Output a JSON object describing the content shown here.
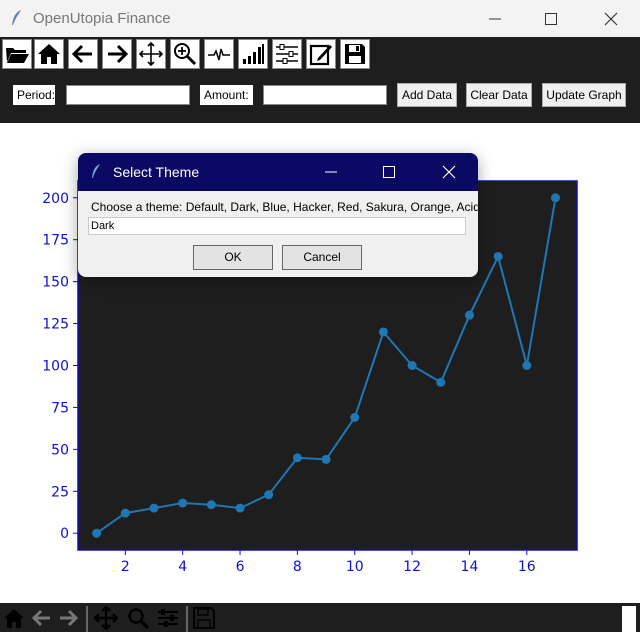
{
  "window": {
    "title": "OpenUtopia Finance"
  },
  "toolbar": {
    "icons": [
      "folder-open-icon",
      "home-icon",
      "arrow-left-icon",
      "arrow-right-icon",
      "move-icon",
      "zoom-in-icon",
      "waveform-icon",
      "signal-bars-icon",
      "sliders-icon",
      "edit-icon",
      "save-icon"
    ]
  },
  "form": {
    "period_label": "Period:",
    "period_value": "",
    "amount_label": "Amount:",
    "amount_value": "",
    "add_button": "Add Data",
    "clear_button": "Clear Data",
    "update_button": "Update Graph"
  },
  "dialog": {
    "title": "Select Theme",
    "prompt": "Choose a theme: Default, Dark, Blue, Hacker, Red, Sakura, Orange, Acid",
    "input_value": "Dark",
    "ok_label": "OK",
    "cancel_label": "Cancel"
  },
  "chart_data": {
    "type": "line",
    "x": [
      1,
      2,
      3,
      4,
      5,
      6,
      7,
      8,
      9,
      10,
      11,
      12,
      13,
      14,
      15,
      16,
      17
    ],
    "series": [
      {
        "values": [
          0,
          12,
          15,
          18,
          17,
          15,
          23,
          45,
          44,
          69,
          120,
          100,
          90,
          130,
          165,
          100,
          200
        ]
      }
    ],
    "xticks": [
      2,
      4,
      6,
      8,
      10,
      12,
      14,
      16
    ],
    "yticks": [
      0,
      25,
      50,
      75,
      100,
      125,
      150,
      175,
      200
    ],
    "xlim": [
      0.35,
      17.75
    ],
    "ylim": [
      -10,
      210
    ],
    "colors": {
      "line": "#1f77b4",
      "plot_bg": "#1e1e1e",
      "tick": "#1010cc",
      "frame": "#1010aa"
    }
  },
  "navbar": {
    "icons": [
      "home-icon",
      "back-icon",
      "forward-icon",
      "pan-icon",
      "zoom-icon",
      "configure-icon",
      "save-icon"
    ]
  }
}
